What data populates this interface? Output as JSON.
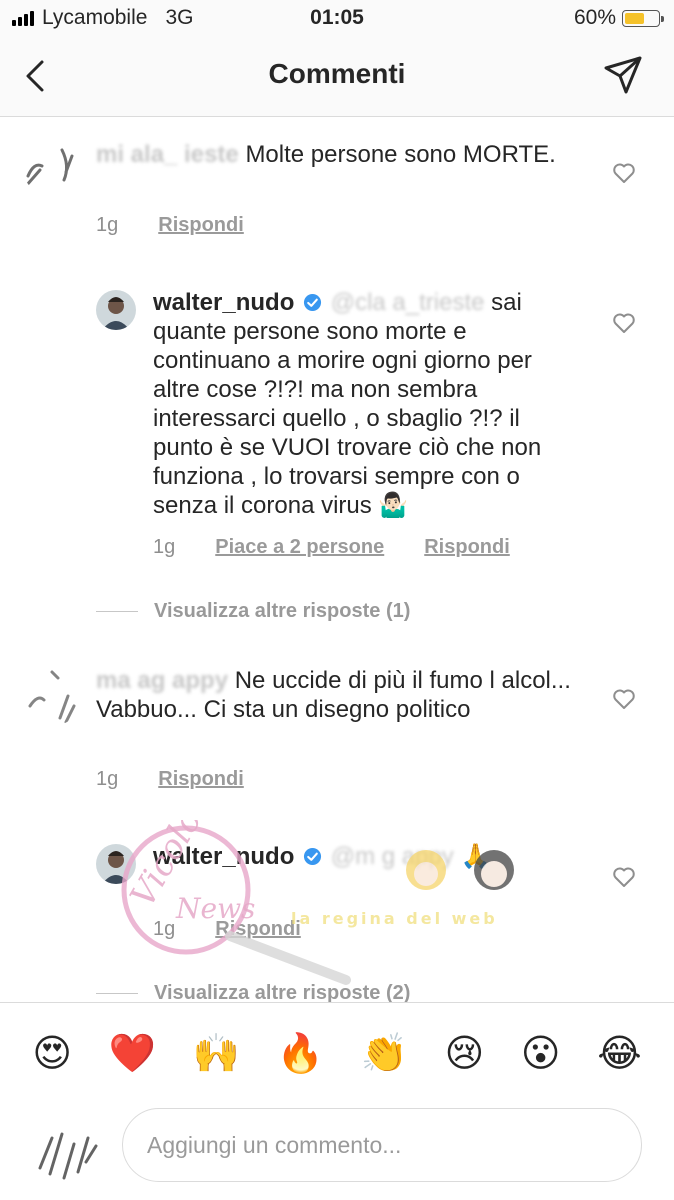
{
  "status_bar": {
    "carrier": "Lycamobile",
    "network": "3G",
    "time": "01:05",
    "battery_percent": "60%",
    "battery_level": 0.6,
    "icons": [
      "signal-icon",
      "battery-icon"
    ]
  },
  "header": {
    "title": "Commenti",
    "back_icon": "chevron-left-icon",
    "share_icon": "paper-plane-icon"
  },
  "comments": [
    {
      "username_partial": "mi  ala_  ieste",
      "text": "Molte persone sono MORTE.",
      "time": "1g",
      "reply_label": "Rispondi"
    },
    {
      "username": "walter_nudo",
      "mention_partial": "@cla   a_trieste",
      "text": "sai quante persone sono morte e continuano a morire ogni giorno per altre cose ?!?! ma non sembra interessarci quello , o sbaglio ?!? il punto è se VUOI trovare ciò che non funziona , lo trovarsi sempre con o senza il corona virus 🤷🏻‍♂️",
      "time": "1g",
      "likes_label": "Piace a 2 persone",
      "reply_label": "Rispondi"
    },
    {
      "username_partial": "ma   ag   appy",
      "text": "Ne uccide di più il fumo l alcol... Vabbuo... Ci sta un disegno politico",
      "time": "1g",
      "reply_label": "Rispondi"
    },
    {
      "username": "walter_nudo",
      "mention_partial": "@m   g   appy",
      "text": "🙏",
      "time": "1g",
      "reply_label": "Rispondi"
    }
  ],
  "more_replies": [
    "Visualizza altre risposte (1)",
    "Visualizza altre risposte (2)"
  ],
  "watermark": {
    "logo_text": "Vicolo delle News",
    "banner_text": "la regina del web"
  },
  "emoji_bar": [
    "😍",
    "❤️",
    "🙌",
    "🔥",
    "👏",
    "😢",
    "😮",
    "😂"
  ],
  "composer": {
    "placeholder": "Aggiungi un commento..."
  },
  "colors": {
    "text": "#262626",
    "meta": "#8e8e8e",
    "verified": "#3897f0",
    "battery": "#f5c22a",
    "divider": "#dbdbdb"
  }
}
